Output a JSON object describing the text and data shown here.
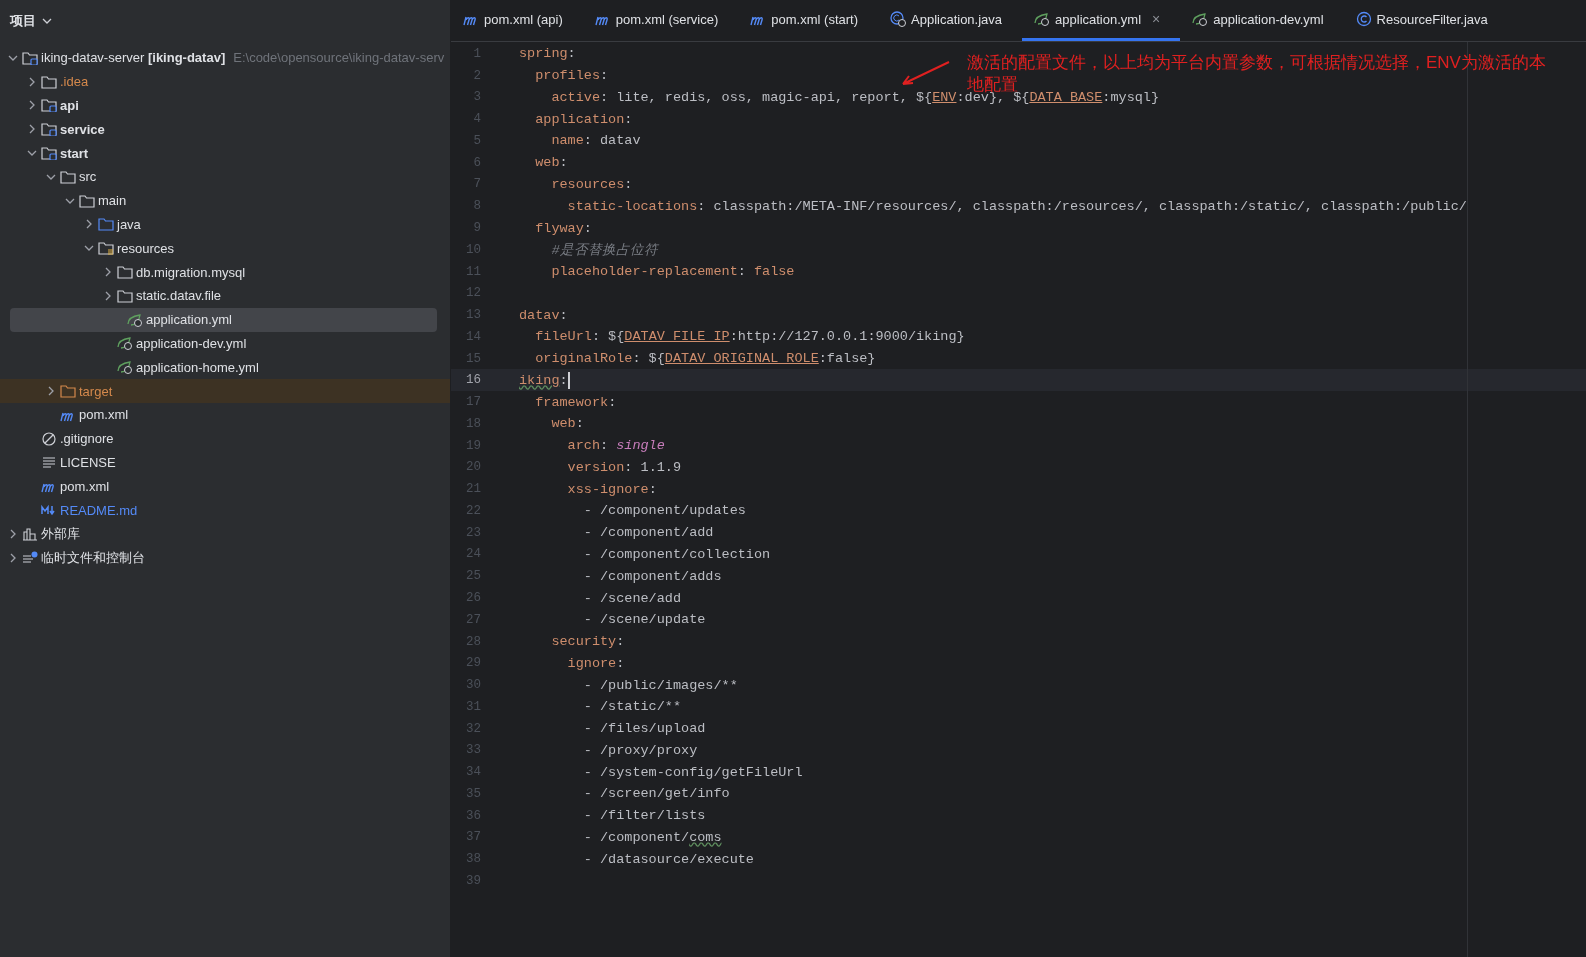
{
  "sidebar": {
    "title": "项目",
    "tree": [
      {
        "kind": "project",
        "label": "iking-datav-server **[iking-datav]**",
        "path": "E:\\code\\opensource\\iking-datav-serv",
        "expanded": true,
        "selected": false,
        "children": [
          {
            "kind": "ignored-folder",
            "label": ".idea",
            "expanded": false,
            "selected": false
          },
          {
            "kind": "module",
            "label": "api",
            "expanded": false,
            "selected": false
          },
          {
            "kind": "module",
            "label": "service",
            "expanded": false,
            "selected": false
          },
          {
            "kind": "module",
            "label": "start",
            "expanded": true,
            "selected": false,
            "children": [
              {
                "kind": "folder",
                "label": "src",
                "expanded": true,
                "selected": false,
                "children": [
                  {
                    "kind": "folder",
                    "label": "main",
                    "expanded": true,
                    "selected": false,
                    "children": [
                      {
                        "kind": "source-folder",
                        "label": "java",
                        "expanded": false,
                        "selected": false
                      },
                      {
                        "kind": "resources-folder",
                        "label": "resources",
                        "expanded": true,
                        "selected": false,
                        "children": [
                          {
                            "kind": "folder",
                            "label": "db.migration.mysql",
                            "expanded": false,
                            "selected": false
                          },
                          {
                            "kind": "folder",
                            "label": "static.datav.file",
                            "expanded": false,
                            "selected": false
                          },
                          {
                            "kind": "yml",
                            "label": "application.yml",
                            "selected": true
                          },
                          {
                            "kind": "yml",
                            "label": "application-dev.yml",
                            "selected": false
                          },
                          {
                            "kind": "yml",
                            "label": "application-home.yml",
                            "selected": false
                          }
                        ]
                      }
                    ]
                  }
                ]
              },
              {
                "kind": "excluded-folder",
                "label": "target",
                "expanded": false,
                "selected": false
              },
              {
                "kind": "maven",
                "label": "pom.xml",
                "selected": false
              }
            ]
          },
          {
            "kind": "ignore-file",
            "label": ".gitignore",
            "selected": false
          },
          {
            "kind": "text-file",
            "label": "LICENSE",
            "selected": false
          },
          {
            "kind": "maven",
            "label": "pom.xml",
            "selected": false
          },
          {
            "kind": "markdown",
            "label": "README.md",
            "selected": false
          }
        ]
      },
      {
        "kind": "libraries",
        "label": "外部库",
        "expanded": false,
        "selected": false
      },
      {
        "kind": "scratches",
        "label": "临时文件和控制台",
        "expanded": false,
        "selected": false
      }
    ]
  },
  "tabs": [
    {
      "kind": "maven",
      "label": "pom.xml (api)",
      "selected": false
    },
    {
      "kind": "maven",
      "label": "pom.xml (service)",
      "selected": false
    },
    {
      "kind": "maven",
      "label": "pom.xml (start)",
      "selected": false
    },
    {
      "kind": "java-run",
      "label": "Application.java",
      "selected": false
    },
    {
      "kind": "yml",
      "label": "application.yml",
      "selected": true,
      "close": "×"
    },
    {
      "kind": "yml",
      "label": "application-dev.yml",
      "selected": false
    },
    {
      "kind": "class",
      "label": "ResourceFilter.java",
      "selected": false
    }
  ],
  "editor": {
    "lines": [
      {
        "n": "1",
        "current": false,
        "tokens": [
          {
            "kind": "key",
            "text": "spring"
          },
          {
            "kind": "text",
            "text": ":"
          }
        ]
      },
      {
        "n": "2",
        "current": false,
        "tokens": [
          {
            "kind": "key",
            "text": "  profiles"
          },
          {
            "kind": "text",
            "text": ":"
          }
        ]
      },
      {
        "n": "3",
        "current": false,
        "tokens": [
          {
            "kind": "key",
            "text": "    active"
          },
          {
            "kind": "text",
            "text": ": lite, redis, oss, magic-api, report, ${"
          },
          {
            "kind": "env",
            "text": "ENV"
          },
          {
            "kind": "text",
            "text": ":dev}, ${"
          },
          {
            "kind": "env",
            "text": "DATA_BASE"
          },
          {
            "kind": "text",
            "text": ":mysql}"
          }
        ]
      },
      {
        "n": "4",
        "current": false,
        "tokens": [
          {
            "kind": "key",
            "text": "  application"
          },
          {
            "kind": "text",
            "text": ":"
          }
        ]
      },
      {
        "n": "5",
        "current": false,
        "tokens": [
          {
            "kind": "key",
            "text": "    name"
          },
          {
            "kind": "text",
            "text": ": datav"
          }
        ]
      },
      {
        "n": "6",
        "current": false,
        "tokens": [
          {
            "kind": "key",
            "text": "  web"
          },
          {
            "kind": "text",
            "text": ":"
          }
        ]
      },
      {
        "n": "7",
        "current": false,
        "tokens": [
          {
            "kind": "key",
            "text": "    resources"
          },
          {
            "kind": "text",
            "text": ":"
          }
        ]
      },
      {
        "n": "8",
        "current": false,
        "tokens": [
          {
            "kind": "key",
            "text": "      static-locations"
          },
          {
            "kind": "text",
            "text": ": classpath:/META-INF/resources/, classpath:/resources/, classpath:/static/, classpath:/public/"
          }
        ]
      },
      {
        "n": "9",
        "current": false,
        "tokens": [
          {
            "kind": "key",
            "text": "  flyway"
          },
          {
            "kind": "text",
            "text": ":"
          }
        ]
      },
      {
        "n": "10",
        "current": false,
        "tokens": [
          {
            "kind": "comment",
            "text": "    #是否替换占位符"
          }
        ]
      },
      {
        "n": "11",
        "current": false,
        "tokens": [
          {
            "kind": "key",
            "text": "    placeholder-replacement"
          },
          {
            "kind": "text",
            "text": ": "
          },
          {
            "kind": "keyword",
            "text": "false"
          }
        ]
      },
      {
        "n": "12",
        "current": false
      },
      {
        "n": "13",
        "current": false,
        "tokens": [
          {
            "kind": "key",
            "text": "datav"
          },
          {
            "kind": "text",
            "text": ":"
          }
        ]
      },
      {
        "n": "14",
        "current": false,
        "tokens": [
          {
            "kind": "key",
            "text": "  fileUrl"
          },
          {
            "kind": "text",
            "text": ": ${"
          },
          {
            "kind": "env",
            "text": "DATAV_FILE_IP"
          },
          {
            "kind": "text",
            "text": ":http://127.0.0.1:9000/iking}"
          }
        ]
      },
      {
        "n": "15",
        "current": false,
        "tokens": [
          {
            "kind": "key",
            "text": "  originalRole"
          },
          {
            "kind": "text",
            "text": ": ${"
          },
          {
            "kind": "env",
            "text": "DATAV_ORIGINAL_ROLE"
          },
          {
            "kind": "text",
            "text": ":false}"
          }
        ]
      },
      {
        "n": "16",
        "current": true,
        "tokens": [
          {
            "kind": "typo-key",
            "text": "iking"
          },
          {
            "kind": "text",
            "text": ":"
          }
        ]
      },
      {
        "n": "17",
        "current": false,
        "tokens": [
          {
            "kind": "key",
            "text": "  framework"
          },
          {
            "kind": "text",
            "text": ":"
          }
        ]
      },
      {
        "n": "18",
        "current": false,
        "tokens": [
          {
            "kind": "key",
            "text": "    web"
          },
          {
            "kind": "text",
            "text": ":"
          }
        ]
      },
      {
        "n": "19",
        "current": false,
        "tokens": [
          {
            "kind": "key",
            "text": "      arch"
          },
          {
            "kind": "text",
            "text": ": "
          },
          {
            "kind": "italic",
            "text": "single"
          }
        ]
      },
      {
        "n": "20",
        "current": false,
        "tokens": [
          {
            "kind": "key",
            "text": "      version"
          },
          {
            "kind": "text",
            "text": ": 1.1.9"
          }
        ]
      },
      {
        "n": "21",
        "current": false,
        "tokens": [
          {
            "kind": "key",
            "text": "      xss-ignore"
          },
          {
            "kind": "text",
            "text": ":"
          }
        ]
      },
      {
        "n": "22",
        "current": false,
        "tokens": [
          {
            "kind": "text",
            "text": "        - /component/updates"
          }
        ]
      },
      {
        "n": "23",
        "current": false,
        "tokens": [
          {
            "kind": "text",
            "text": "        - /component/add"
          }
        ]
      },
      {
        "n": "24",
        "current": false,
        "tokens": [
          {
            "kind": "text",
            "text": "        - /component/collection"
          }
        ]
      },
      {
        "n": "25",
        "current": false,
        "tokens": [
          {
            "kind": "text",
            "text": "        - /component/adds"
          }
        ]
      },
      {
        "n": "26",
        "current": false,
        "tokens": [
          {
            "kind": "text",
            "text": "        - /scene/add"
          }
        ]
      },
      {
        "n": "27",
        "current": false,
        "tokens": [
          {
            "kind": "text",
            "text": "        - /scene/update"
          }
        ]
      },
      {
        "n": "28",
        "current": false,
        "tokens": [
          {
            "kind": "key",
            "text": "    security"
          },
          {
            "kind": "text",
            "text": ":"
          }
        ]
      },
      {
        "n": "29",
        "current": false,
        "tokens": [
          {
            "kind": "key",
            "text": "      ignore"
          },
          {
            "kind": "text",
            "text": ":"
          }
        ]
      },
      {
        "n": "30",
        "current": false,
        "tokens": [
          {
            "kind": "text",
            "text": "        - /public/images/**"
          }
        ]
      },
      {
        "n": "31",
        "current": false,
        "tokens": [
          {
            "kind": "text",
            "text": "        - /static/**"
          }
        ]
      },
      {
        "n": "32",
        "current": false,
        "tokens": [
          {
            "kind": "text",
            "text": "        - /files/upload"
          }
        ]
      },
      {
        "n": "33",
        "current": false,
        "tokens": [
          {
            "kind": "text",
            "text": "        - /proxy/proxy"
          }
        ]
      },
      {
        "n": "34",
        "current": false,
        "tokens": [
          {
            "kind": "text",
            "text": "        - /system-config/getFileUrl"
          }
        ]
      },
      {
        "n": "35",
        "current": false,
        "tokens": [
          {
            "kind": "text",
            "text": "        - /screen/get/info"
          }
        ]
      },
      {
        "n": "36",
        "current": false,
        "tokens": [
          {
            "kind": "text",
            "text": "        - /filter/lists"
          }
        ]
      },
      {
        "n": "37",
        "current": false,
        "tokens": [
          {
            "kind": "text",
            "text": "        - /component/"
          },
          {
            "kind": "typo-text",
            "text": "coms"
          }
        ]
      },
      {
        "n": "38",
        "current": false,
        "tokens": [
          {
            "kind": "text",
            "text": "        - /datasource/execute"
          }
        ]
      },
      {
        "n": "39",
        "current": false
      }
    ],
    "annotation": "激活的配置文件，以上均为平台内置参数，可根据情况选择，ENV为激活的本地配置"
  }
}
